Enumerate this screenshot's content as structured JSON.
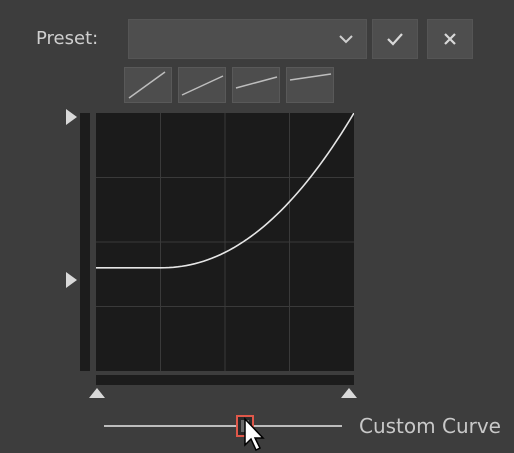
{
  "preset": {
    "label": "Preset:",
    "value": "",
    "dropdown_icon": "chevron-down-icon",
    "apply_icon": "check-icon",
    "cancel_icon": "close-icon"
  },
  "curve_presets": [
    {
      "name": "linear-preset",
      "icon": "curve-linear-icon"
    },
    {
      "name": "slight-preset",
      "icon": "curve-slight-icon"
    },
    {
      "name": "flatter-preset",
      "icon": "curve-flatter-icon"
    },
    {
      "name": "flattest-preset",
      "icon": "curve-flattest-icon"
    }
  ],
  "curve_editor": {
    "grid_divisions": 4,
    "curve_points": [
      [
        0,
        0.4
      ],
      [
        0.25,
        0.4
      ],
      [
        0.5,
        0.5
      ],
      [
        0.75,
        0.7
      ],
      [
        1,
        1
      ]
    ]
  },
  "slider": {
    "label": "Custom Curve",
    "value": 0.6
  },
  "colors": {
    "background": "#3d3d3d",
    "graph_bg": "#1b1b1b",
    "grid": "#3a3a3a",
    "curve": "#e6e6e6",
    "handle_border": "#e0584a"
  }
}
